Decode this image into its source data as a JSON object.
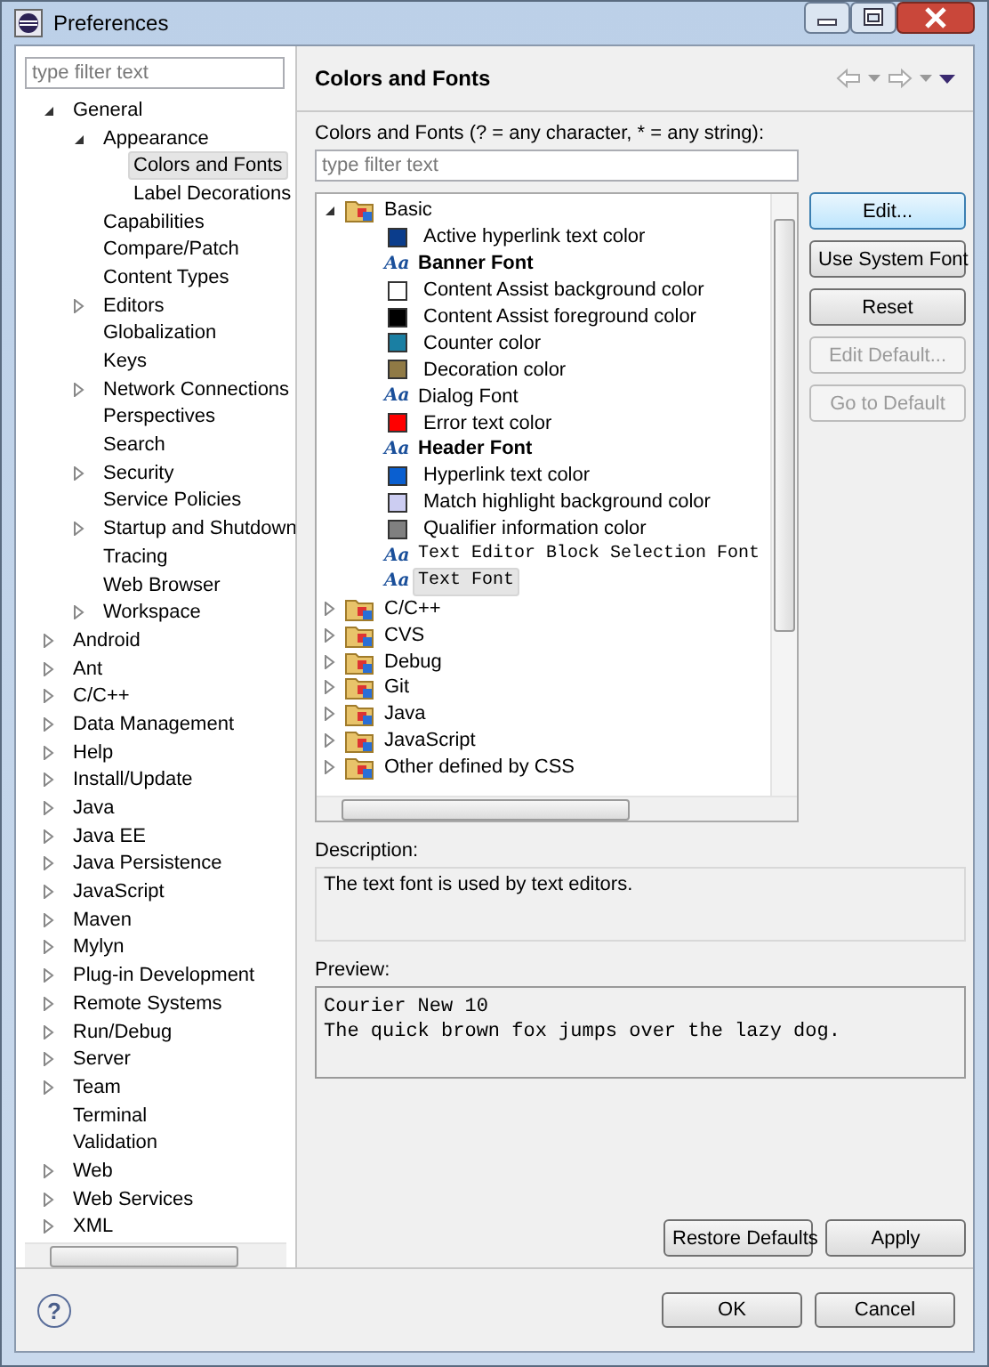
{
  "window": {
    "title": "Preferences"
  },
  "sidebar": {
    "filter": {
      "placeholder": "type filter text"
    },
    "items": [
      {
        "label": "General",
        "expanded": true,
        "selected": false,
        "children": [
          {
            "label": "Appearance",
            "expanded": true,
            "selected": false,
            "children": [
              {
                "label": "Colors and Fonts",
                "selected": true
              },
              {
                "label": "Label Decorations",
                "selected": false
              }
            ]
          },
          {
            "label": "Capabilities",
            "selected": false
          },
          {
            "label": "Compare/Patch",
            "selected": false
          },
          {
            "label": "Content Types",
            "selected": false
          },
          {
            "label": "Editors",
            "expanded": false,
            "selected": false
          },
          {
            "label": "Globalization",
            "selected": false
          },
          {
            "label": "Keys",
            "selected": false
          },
          {
            "label": "Network Connections",
            "expanded": false,
            "selected": false
          },
          {
            "label": "Perspectives",
            "selected": false
          },
          {
            "label": "Search",
            "selected": false
          },
          {
            "label": "Security",
            "expanded": false,
            "selected": false
          },
          {
            "label": "Service Policies",
            "selected": false
          },
          {
            "label": "Startup and Shutdown",
            "expanded": false,
            "selected": false
          },
          {
            "label": "Tracing",
            "selected": false
          },
          {
            "label": "Web Browser",
            "selected": false
          },
          {
            "label": "Workspace",
            "expanded": false,
            "selected": false
          }
        ]
      },
      {
        "label": "Android",
        "expanded": false,
        "selected": false
      },
      {
        "label": "Ant",
        "expanded": false,
        "selected": false
      },
      {
        "label": "C/C++",
        "expanded": false,
        "selected": false
      },
      {
        "label": "Data Management",
        "expanded": false,
        "selected": false
      },
      {
        "label": "Help",
        "expanded": false,
        "selected": false
      },
      {
        "label": "Install/Update",
        "expanded": false,
        "selected": false
      },
      {
        "label": "Java",
        "expanded": false,
        "selected": false
      },
      {
        "label": "Java EE",
        "expanded": false,
        "selected": false
      },
      {
        "label": "Java Persistence",
        "expanded": false,
        "selected": false
      },
      {
        "label": "JavaScript",
        "expanded": false,
        "selected": false
      },
      {
        "label": "Maven",
        "expanded": false,
        "selected": false
      },
      {
        "label": "Mylyn",
        "expanded": false,
        "selected": false
      },
      {
        "label": "Plug-in Development",
        "expanded": false,
        "selected": false
      },
      {
        "label": "Remote Systems",
        "expanded": false,
        "selected": false
      },
      {
        "label": "Run/Debug",
        "expanded": false,
        "selected": false
      },
      {
        "label": "Server",
        "expanded": false,
        "selected": false
      },
      {
        "label": "Team",
        "expanded": false,
        "selected": false
      },
      {
        "label": "Terminal",
        "selected": false
      },
      {
        "label": "Validation",
        "selected": false
      },
      {
        "label": "Web",
        "expanded": false,
        "selected": false
      },
      {
        "label": "Web Services",
        "expanded": false,
        "selected": false
      },
      {
        "label": "XML",
        "expanded": false,
        "selected": false
      }
    ]
  },
  "page": {
    "title": "Colors and Fonts",
    "filter_label": "Colors and Fonts (? = any character, * = any string):",
    "filter": {
      "placeholder": "type filter text"
    },
    "tree": [
      {
        "label": "Basic",
        "kind": "category",
        "expanded": true,
        "selected": false,
        "children": [
          {
            "label": "Active hyperlink text color",
            "kind": "color",
            "color": "#0b3d8c",
            "selected": false
          },
          {
            "label": "Banner Font",
            "kind": "boldfont",
            "glyph": "Aa",
            "selected": false
          },
          {
            "label": "Content Assist background color",
            "kind": "color",
            "color": "#ffffff",
            "selected": false
          },
          {
            "label": "Content Assist foreground color",
            "kind": "color",
            "color": "#000000",
            "selected": false
          },
          {
            "label": "Counter color",
            "kind": "color",
            "color": "#1a7fa3",
            "selected": false
          },
          {
            "label": "Decoration color",
            "kind": "color",
            "color": "#907a45",
            "selected": false
          },
          {
            "label": "Dialog Font",
            "kind": "font",
            "glyph": "Aa",
            "selected": false
          },
          {
            "label": "Error text color",
            "kind": "color",
            "color": "#ff0000",
            "selected": false
          },
          {
            "label": "Header Font",
            "kind": "boldfont",
            "glyph": "Aa",
            "selected": false
          },
          {
            "label": "Hyperlink text color",
            "kind": "color",
            "color": "#0a5fd0",
            "selected": false
          },
          {
            "label": "Match highlight background color",
            "kind": "color",
            "color": "#cccdf2",
            "selected": false
          },
          {
            "label": "Qualifier information color",
            "kind": "color",
            "color": "#808080",
            "selected": false
          },
          {
            "label": "Text Editor Block Selection Font",
            "kind": "monofont",
            "glyph": "Aa",
            "selected": false
          },
          {
            "label": "Text Font",
            "kind": "monofont",
            "glyph": "Aa",
            "selected": true
          }
        ]
      },
      {
        "label": "C/C++",
        "kind": "category",
        "expanded": false,
        "selected": false
      },
      {
        "label": "CVS",
        "kind": "category",
        "expanded": false,
        "selected": false
      },
      {
        "label": "Debug",
        "kind": "category",
        "expanded": false,
        "selected": false
      },
      {
        "label": "Git",
        "kind": "category",
        "expanded": false,
        "selected": false
      },
      {
        "label": "Java",
        "kind": "category",
        "expanded": false,
        "selected": false
      },
      {
        "label": "JavaScript",
        "kind": "category",
        "expanded": false,
        "selected": false
      },
      {
        "label": "Other defined by CSS",
        "kind": "category",
        "expanded": false,
        "selected": false
      }
    ],
    "buttons": [
      {
        "label": "Edit...",
        "disabled": false,
        "default": true
      },
      {
        "label": "Use System Font",
        "disabled": false,
        "default": false
      },
      {
        "label": "Reset",
        "disabled": false,
        "default": false
      },
      {
        "label": "Edit Default...",
        "disabled": true,
        "default": false
      },
      {
        "label": "Go to Default",
        "disabled": true,
        "default": false
      }
    ],
    "description_label": "Description:",
    "description": "The text font is used by text editors.",
    "preview_label": "Preview:",
    "preview": [
      "Courier New 10",
      "The quick brown fox jumps over the lazy dog."
    ],
    "actions": [
      "Restore Defaults",
      "Apply"
    ]
  },
  "footer": {
    "help": "?",
    "buttons": [
      "OK",
      "Cancel"
    ]
  }
}
